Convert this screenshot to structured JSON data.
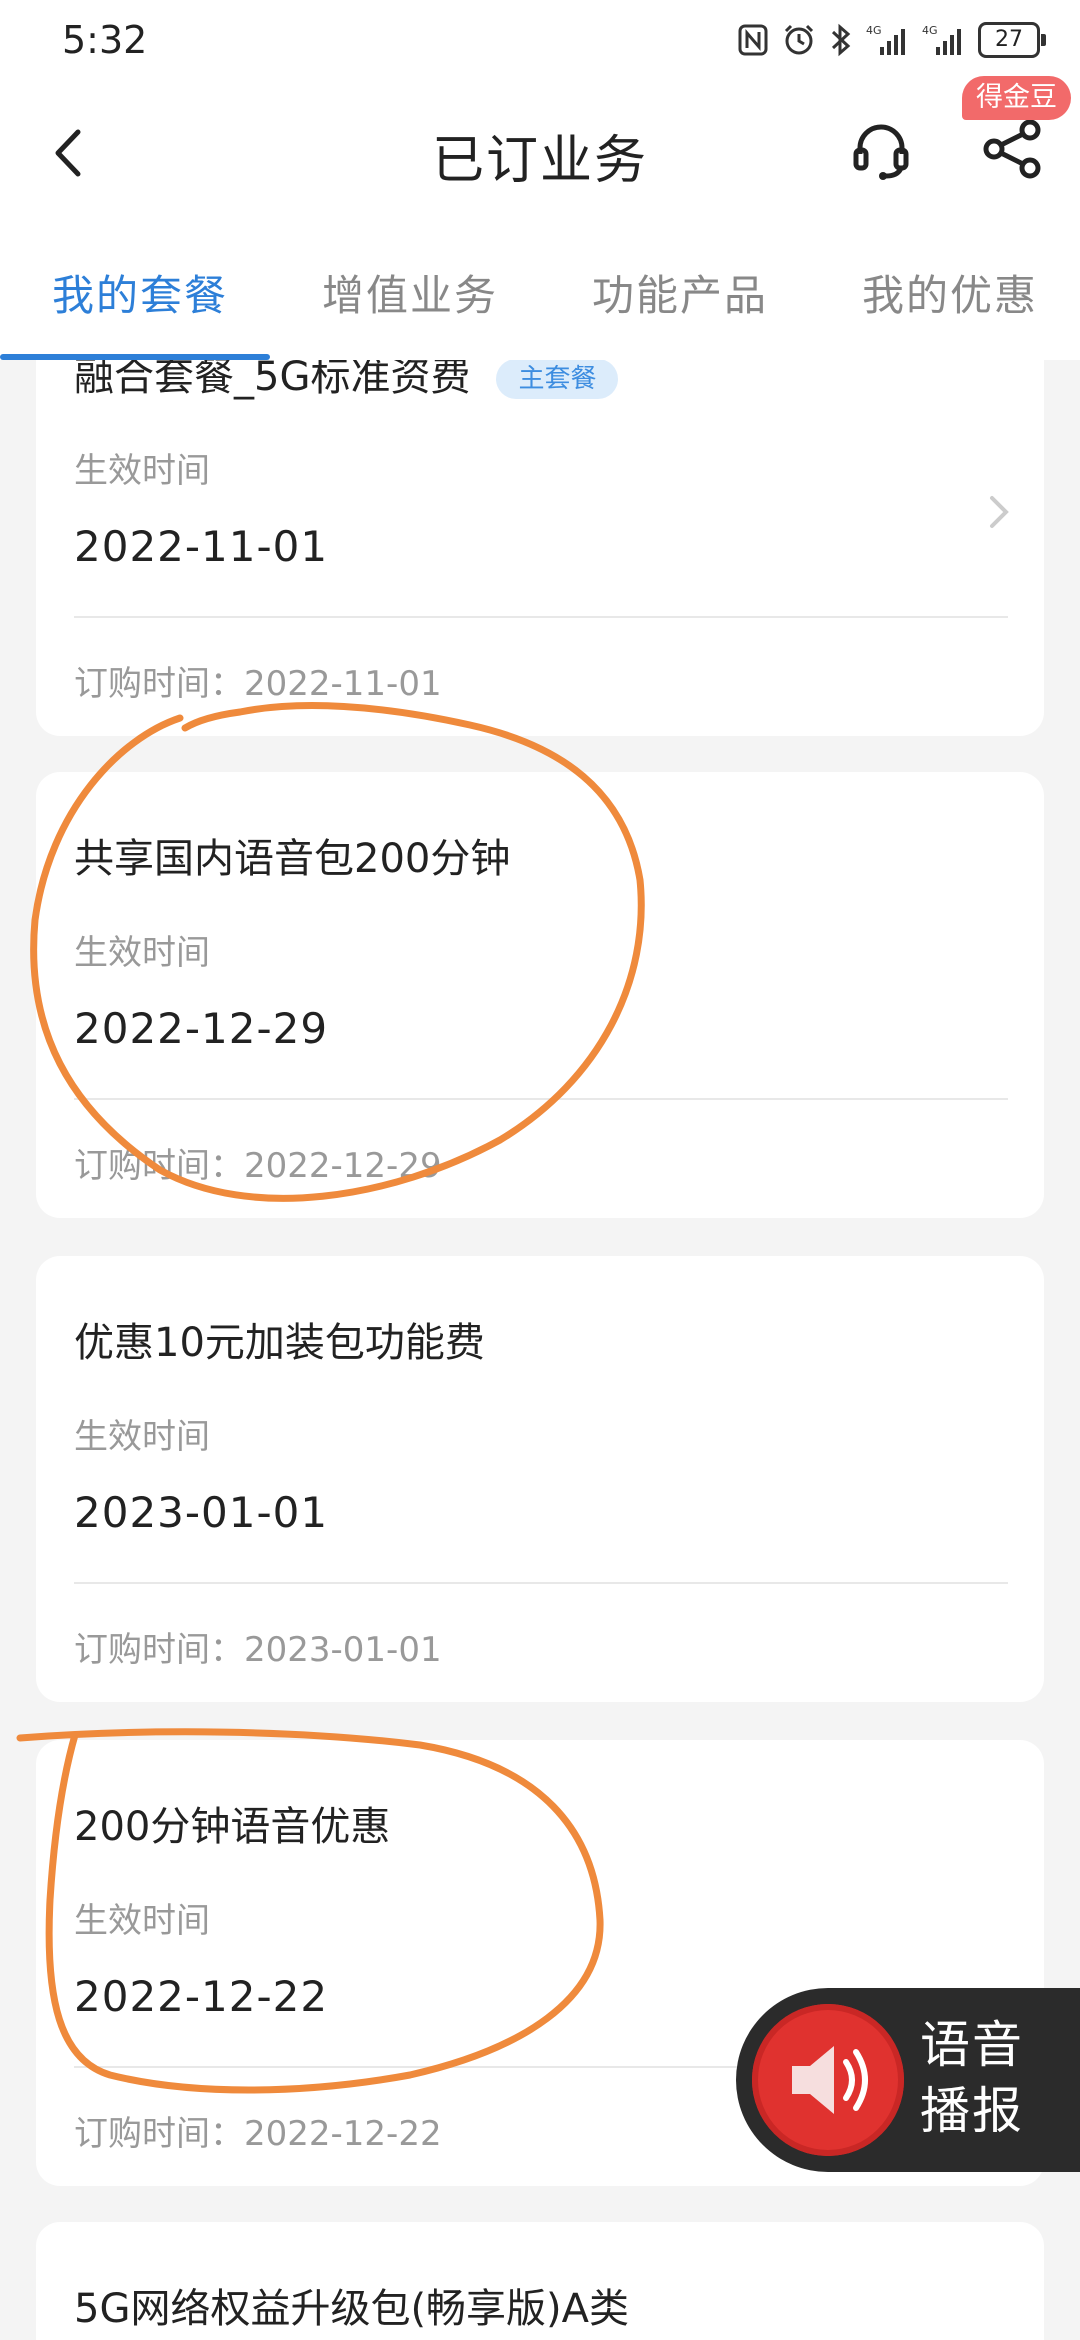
{
  "status": {
    "time": "5:32",
    "battery": "27",
    "icons": [
      "nfc-icon",
      "alarm-icon",
      "bluetooth-icon",
      "signal-4g-icon",
      "signal-4g-icon",
      "battery-icon"
    ]
  },
  "nav": {
    "title": "已订业务",
    "badge": "得金豆",
    "icons": [
      "back-arrow-icon",
      "headset-icon",
      "share-icon"
    ]
  },
  "tabs": [
    {
      "label": "我的套餐",
      "active": true
    },
    {
      "label": "增值业务",
      "active": false
    },
    {
      "label": "功能产品",
      "active": false
    },
    {
      "label": "我的优惠",
      "active": false
    }
  ],
  "cards": [
    {
      "title": "融合套餐_5G标准资费",
      "badge": "主套餐",
      "effective_label": "生效时间",
      "effective_date": "2022-11-01",
      "order_label": "订购时间：",
      "order_date": "2022-11-01"
    },
    {
      "title": "共享国内语音包200分钟",
      "effective_label": "生效时间",
      "effective_date": "2022-12-29",
      "order_label": "订购时间：",
      "order_date": "2022-12-29"
    },
    {
      "title": "优惠10元加装包功能费",
      "effective_label": "生效时间",
      "effective_date": "2023-01-01",
      "order_label": "订购时间：",
      "order_date": "2023-01-01"
    },
    {
      "title": "200分钟语音优惠",
      "effective_label": "生效时间",
      "effective_date": "2022-12-22",
      "order_label": "订购时间：",
      "order_date": "2022-12-22"
    },
    {
      "title": "5G网络权益升级包(畅享版)A类"
    }
  ],
  "voice_button": {
    "label": "语音播报",
    "icon": "speaker-icon"
  },
  "annotation_color": "#ef8a3c",
  "accent_color": "#2d7fd8"
}
